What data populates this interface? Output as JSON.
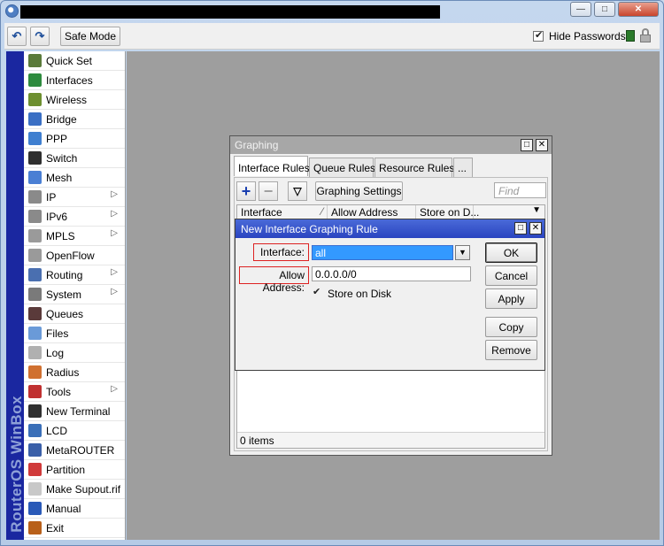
{
  "toolbar": {
    "undo_icon": "undo-icon",
    "redo_icon": "redo-icon",
    "safe_mode": "Safe Mode",
    "hide_passwords": "Hide Passwords",
    "hide_passwords_checked": true
  },
  "brand": "RouterOS WinBox",
  "sidebar": {
    "items": [
      {
        "label": "Quick Set",
        "icon": "wand-icon",
        "color": "#5a7a3a",
        "submenu": false
      },
      {
        "label": "Interfaces",
        "icon": "interfaces-icon",
        "color": "#2e8b3e",
        "submenu": false
      },
      {
        "label": "Wireless",
        "icon": "wireless-icon",
        "color": "#6d8f2f",
        "submenu": false
      },
      {
        "label": "Bridge",
        "icon": "bridge-icon",
        "color": "#3a6fc4",
        "submenu": false
      },
      {
        "label": "PPP",
        "icon": "ppp-icon",
        "color": "#3f7fd0",
        "submenu": false
      },
      {
        "label": "Switch",
        "icon": "switch-icon",
        "color": "#2f2f2f",
        "submenu": false
      },
      {
        "label": "Mesh",
        "icon": "mesh-icon",
        "color": "#4a7fd4",
        "submenu": false
      },
      {
        "label": "IP",
        "icon": "ip-icon",
        "color": "#8a8a8a",
        "submenu": true
      },
      {
        "label": "IPv6",
        "icon": "ipv6-icon",
        "color": "#8a8a8a",
        "submenu": true
      },
      {
        "label": "MPLS",
        "icon": "mpls-icon",
        "color": "#9a9a9a",
        "submenu": true
      },
      {
        "label": "OpenFlow",
        "icon": "openflow-icon",
        "color": "#9a9a9a",
        "submenu": false
      },
      {
        "label": "Routing",
        "icon": "routing-icon",
        "color": "#4a6fb0",
        "submenu": true
      },
      {
        "label": "System",
        "icon": "system-gear-icon",
        "color": "#7a7a7a",
        "submenu": true
      },
      {
        "label": "Queues",
        "icon": "queues-icon",
        "color": "#5a3a3a",
        "submenu": false
      },
      {
        "label": "Files",
        "icon": "folder-icon",
        "color": "#6a9ad8",
        "submenu": false
      },
      {
        "label": "Log",
        "icon": "log-icon",
        "color": "#b0b0b0",
        "submenu": false
      },
      {
        "label": "Radius",
        "icon": "radius-users-icon",
        "color": "#d07030",
        "submenu": false
      },
      {
        "label": "Tools",
        "icon": "tools-icon",
        "color": "#c03030",
        "submenu": true
      },
      {
        "label": "New Terminal",
        "icon": "terminal-icon",
        "color": "#303030",
        "submenu": false
      },
      {
        "label": "LCD",
        "icon": "lcd-icon",
        "color": "#3a6fb8",
        "submenu": false
      },
      {
        "label": "MetaROUTER",
        "icon": "metarouter-icon",
        "color": "#3a5fa8",
        "submenu": false
      },
      {
        "label": "Partition",
        "icon": "partition-pie-icon",
        "color": "#d03a3a",
        "submenu": false
      },
      {
        "label": "Make Supout.rif",
        "icon": "document-icon",
        "color": "#c8c8c8",
        "submenu": false
      },
      {
        "label": "Manual",
        "icon": "help-icon",
        "color": "#2a5ab8",
        "submenu": false
      },
      {
        "label": "Exit",
        "icon": "exit-door-icon",
        "color": "#b8601a",
        "submenu": false
      }
    ]
  },
  "graphing": {
    "title": "Graphing",
    "tabs": [
      "Interface Rules",
      "Queue Rules",
      "Resource Rules",
      "..."
    ],
    "graphing_settings": "Graphing Settings",
    "find_placeholder": "Find",
    "columns": [
      "Interface",
      "Allow Address",
      "Store on D..."
    ],
    "status": "0 items"
  },
  "dialog": {
    "title": "New Interface Graphing Rule",
    "interface_label": "Interface:",
    "interface_value": "all",
    "allow_address_label": "Allow Address:",
    "allow_address_value": "0.0.0.0/0",
    "store_on_disk": "Store on Disk",
    "store_on_disk_checked": true,
    "buttons": {
      "ok": "OK",
      "cancel": "Cancel",
      "apply": "Apply",
      "copy": "Copy",
      "remove": "Remove"
    }
  },
  "colors": {
    "accent": "#2a44c0",
    "sidebar_strip": "#1a27a0",
    "highlight_box": "#dd2222",
    "selection": "#3399ff"
  }
}
